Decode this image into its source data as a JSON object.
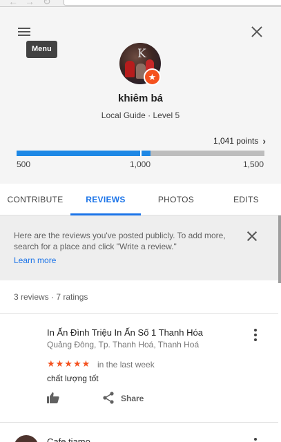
{
  "profile": {
    "menu_tooltip": "Menu",
    "name": "khiêm bá",
    "subtitle": "Local Guide · Level 5",
    "points_label": "1,041 points",
    "points_chevron": "›",
    "progress_fraction": 0.541,
    "scale": [
      "500",
      "1,000",
      "1,500"
    ]
  },
  "tabs": [
    {
      "label": "CONTRIBUTE",
      "active": false
    },
    {
      "label": "REVIEWS",
      "active": true
    },
    {
      "label": "PHOTOS",
      "active": false
    },
    {
      "label": "EDITS",
      "active": false
    }
  ],
  "info": {
    "text": "Here are the reviews you've posted publicly. To add more, search for a place and click \"Write a review.\"",
    "link": "Learn more"
  },
  "reviews_summary": "3 reviews · 7 ratings",
  "reviews": [
    {
      "place": "In Ấn Đình Triệu In Ấn Số 1 Thanh Hóa",
      "address": "Quảng Đông, Tp. Thanh Hoá, Thanh Hoá",
      "stars": "★★★★★",
      "rating": 5,
      "when": "in the last week",
      "text": "chất lượng tốt",
      "share_label": "Share"
    },
    {
      "place": "Cafe tiamo"
    }
  ],
  "colors": {
    "accent": "#1a73e8",
    "star": "#f4511e",
    "badge": "#f4511e",
    "progress_fill": "#1e88e5"
  },
  "icons": {
    "menu": "menu-icon",
    "close": "close-icon",
    "badge": "star-badge-icon",
    "more": "more-vert-icon",
    "like": "thumb-up-icon",
    "share": "share-icon"
  }
}
